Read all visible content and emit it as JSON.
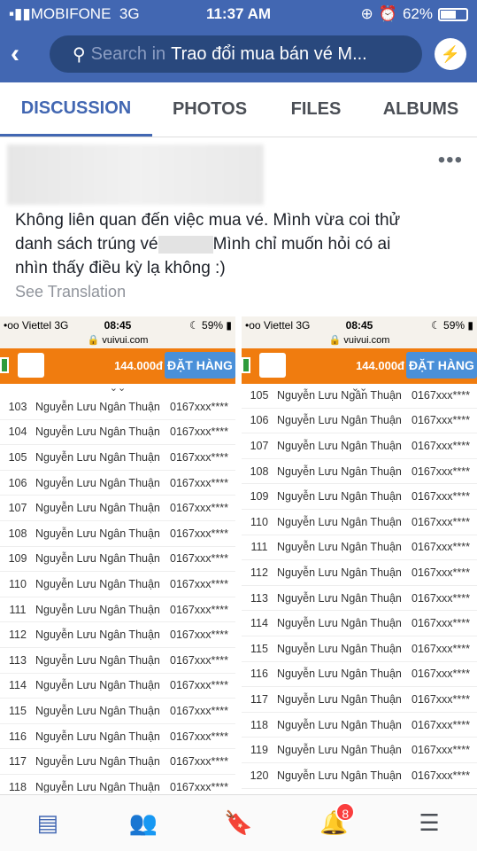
{
  "status": {
    "carrier": "MOBIFONE",
    "network": "3G",
    "time": "11:37 AM",
    "battery": "62%",
    "battery_level": 0.62
  },
  "header": {
    "search_prefix": "Search in",
    "search_group": "Trao đổi mua bán vé M..."
  },
  "tabs": [
    {
      "label": "DISCUSSION",
      "active": true
    },
    {
      "label": "PHOTOS"
    },
    {
      "label": "FILES"
    },
    {
      "label": "ALBUMS"
    }
  ],
  "post": {
    "line1": "Không liên quan đến việc mua vé. Mình vừa coi thử",
    "line2a": "danh sách trúng vé",
    "line2b": "Mình chỉ muốn hỏi có ai",
    "line3": "nhìn thấy điều kỳ lạ không :)",
    "see_translation": "See Translation",
    "more": "•••"
  },
  "screenshots": [
    {
      "carrier": "•oo Viettel  3G",
      "time": "08:45",
      "battery": "☾ 59% ▮",
      "url": "🔒 vuivui.com",
      "price": "144.000đ",
      "order": "ĐẶT HÀNG",
      "rows": [
        [
          "103",
          "Nguyễn Lưu Ngân Thuận",
          "0167xxx****"
        ],
        [
          "104",
          "Nguyễn Lưu Ngân Thuận",
          "0167xxx****"
        ],
        [
          "105",
          "Nguyễn Lưu Ngân Thuận",
          "0167xxx****"
        ],
        [
          "106",
          "Nguyễn Lưu Ngân Thuận",
          "0167xxx****"
        ],
        [
          "107",
          "Nguyễn Lưu Ngân Thuận",
          "0167xxx****"
        ],
        [
          "108",
          "Nguyễn Lưu Ngân Thuận",
          "0167xxx****"
        ],
        [
          "109",
          "Nguyễn Lưu Ngân Thuận",
          "0167xxx****"
        ],
        [
          "110",
          "Nguyễn Lưu Ngân Thuận",
          "0167xxx****"
        ],
        [
          "111",
          "Nguyễn Lưu Ngân Thuận",
          "0167xxx****"
        ],
        [
          "112",
          "Nguyễn Lưu Ngân Thuận",
          "0167xxx****"
        ],
        [
          "113",
          "Nguyễn Lưu Ngân Thuận",
          "0167xxx****"
        ],
        [
          "114",
          "Nguyễn Lưu Ngân Thuận",
          "0167xxx****"
        ],
        [
          "115",
          "Nguyễn Lưu Ngân Thuận",
          "0167xxx****"
        ],
        [
          "116",
          "Nguyễn Lưu Ngân Thuận",
          "0167xxx****"
        ],
        [
          "117",
          "Nguyễn Lưu Ngân Thuận",
          "0167xxx****"
        ],
        [
          "118",
          "Nguyễn Lưu Ngân Thuận",
          "0167xxx****"
        ]
      ]
    },
    {
      "carrier": "•oo Viettel  3G",
      "time": "08:45",
      "battery": "☾ 59% ▮",
      "url": "🔒 vuivui.com",
      "price": "144.000đ",
      "order": "ĐẶT HÀNG",
      "rows": [
        [
          "105",
          "Nguyễn Lưu Ngân Thuận",
          "0167xxx****"
        ],
        [
          "106",
          "Nguyễn Lưu Ngân Thuận",
          "0167xxx****"
        ],
        [
          "107",
          "Nguyễn Lưu Ngân Thuận",
          "0167xxx****"
        ],
        [
          "108",
          "Nguyễn Lưu Ngân Thuận",
          "0167xxx****"
        ],
        [
          "109",
          "Nguyễn Lưu Ngân Thuận",
          "0167xxx****"
        ],
        [
          "110",
          "Nguyễn Lưu Ngân Thuận",
          "0167xxx****"
        ],
        [
          "111",
          "Nguyễn Lưu Ngân Thuận",
          "0167xxx****"
        ],
        [
          "112",
          "Nguyễn Lưu Ngân Thuận",
          "0167xxx****"
        ],
        [
          "113",
          "Nguyễn Lưu Ngân Thuận",
          "0167xxx****"
        ],
        [
          "114",
          "Nguyễn Lưu Ngân Thuận",
          "0167xxx****"
        ],
        [
          "115",
          "Nguyễn Lưu Ngân Thuận",
          "0167xxx****"
        ],
        [
          "116",
          "Nguyễn Lưu Ngân Thuận",
          "0167xxx****"
        ],
        [
          "117",
          "Nguyễn Lưu Ngân Thuận",
          "0167xxx****"
        ],
        [
          "118",
          "Nguyễn Lưu Ngân Thuận",
          "0167xxx****"
        ],
        [
          "119",
          "Nguyễn Lưu Ngân Thuận",
          "0167xxx****"
        ],
        [
          "120",
          "Nguyễn Lưu Ngân Thuận",
          "0167xxx****"
        ]
      ]
    }
  ],
  "bottom_nav": {
    "notifications_badge": "8"
  },
  "colors": {
    "brand": "#4267b2",
    "orange": "#f07c0f",
    "badge": "#fa3e3e"
  }
}
